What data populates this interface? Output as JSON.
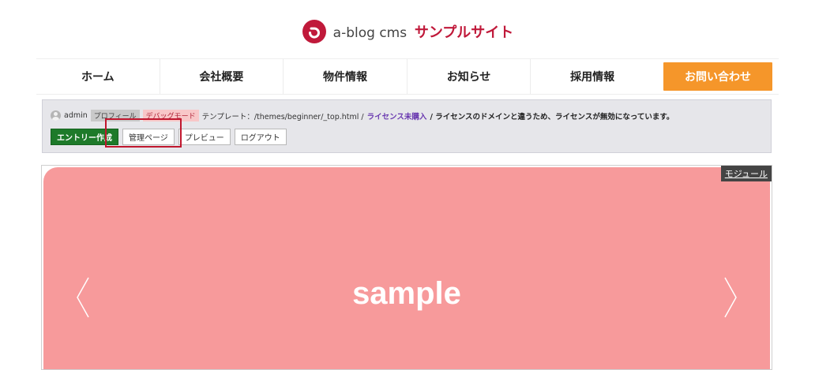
{
  "header": {
    "brand": "a-blog cms",
    "site_name": "サンプルサイト"
  },
  "nav": {
    "items": [
      {
        "label": "ホーム"
      },
      {
        "label": "会社概要"
      },
      {
        "label": "物件情報"
      },
      {
        "label": "お知らせ"
      },
      {
        "label": "採用情報"
      }
    ],
    "contact_label": "お問い合わせ"
  },
  "admin_bar": {
    "user": "admin",
    "profile_tag": "プロフィール",
    "debug_tag": "デバッグモード",
    "template_text": "テンプレート：/themes/beginner/_top.html /",
    "license_link": "ライセンス未購入",
    "license_message": "/ ライセンスのドメインと違うため、ライセンスが無効になっています。",
    "buttons": {
      "create_entry": "エントリー作成",
      "admin_page": "管理ページ",
      "preview": "プレビュー",
      "logout": "ログアウト"
    }
  },
  "slider": {
    "slide_text": "sample",
    "module_label": "モジュール",
    "prev_icon": "chevron-left-icon",
    "next_icon": "chevron-right-icon",
    "slide_color": "#f79a9b"
  },
  "colors": {
    "accent_red": "#c0193a",
    "contact_orange": "#f5962a",
    "primary_green": "#1e7a2a",
    "highlight_red": "#c0172e"
  }
}
